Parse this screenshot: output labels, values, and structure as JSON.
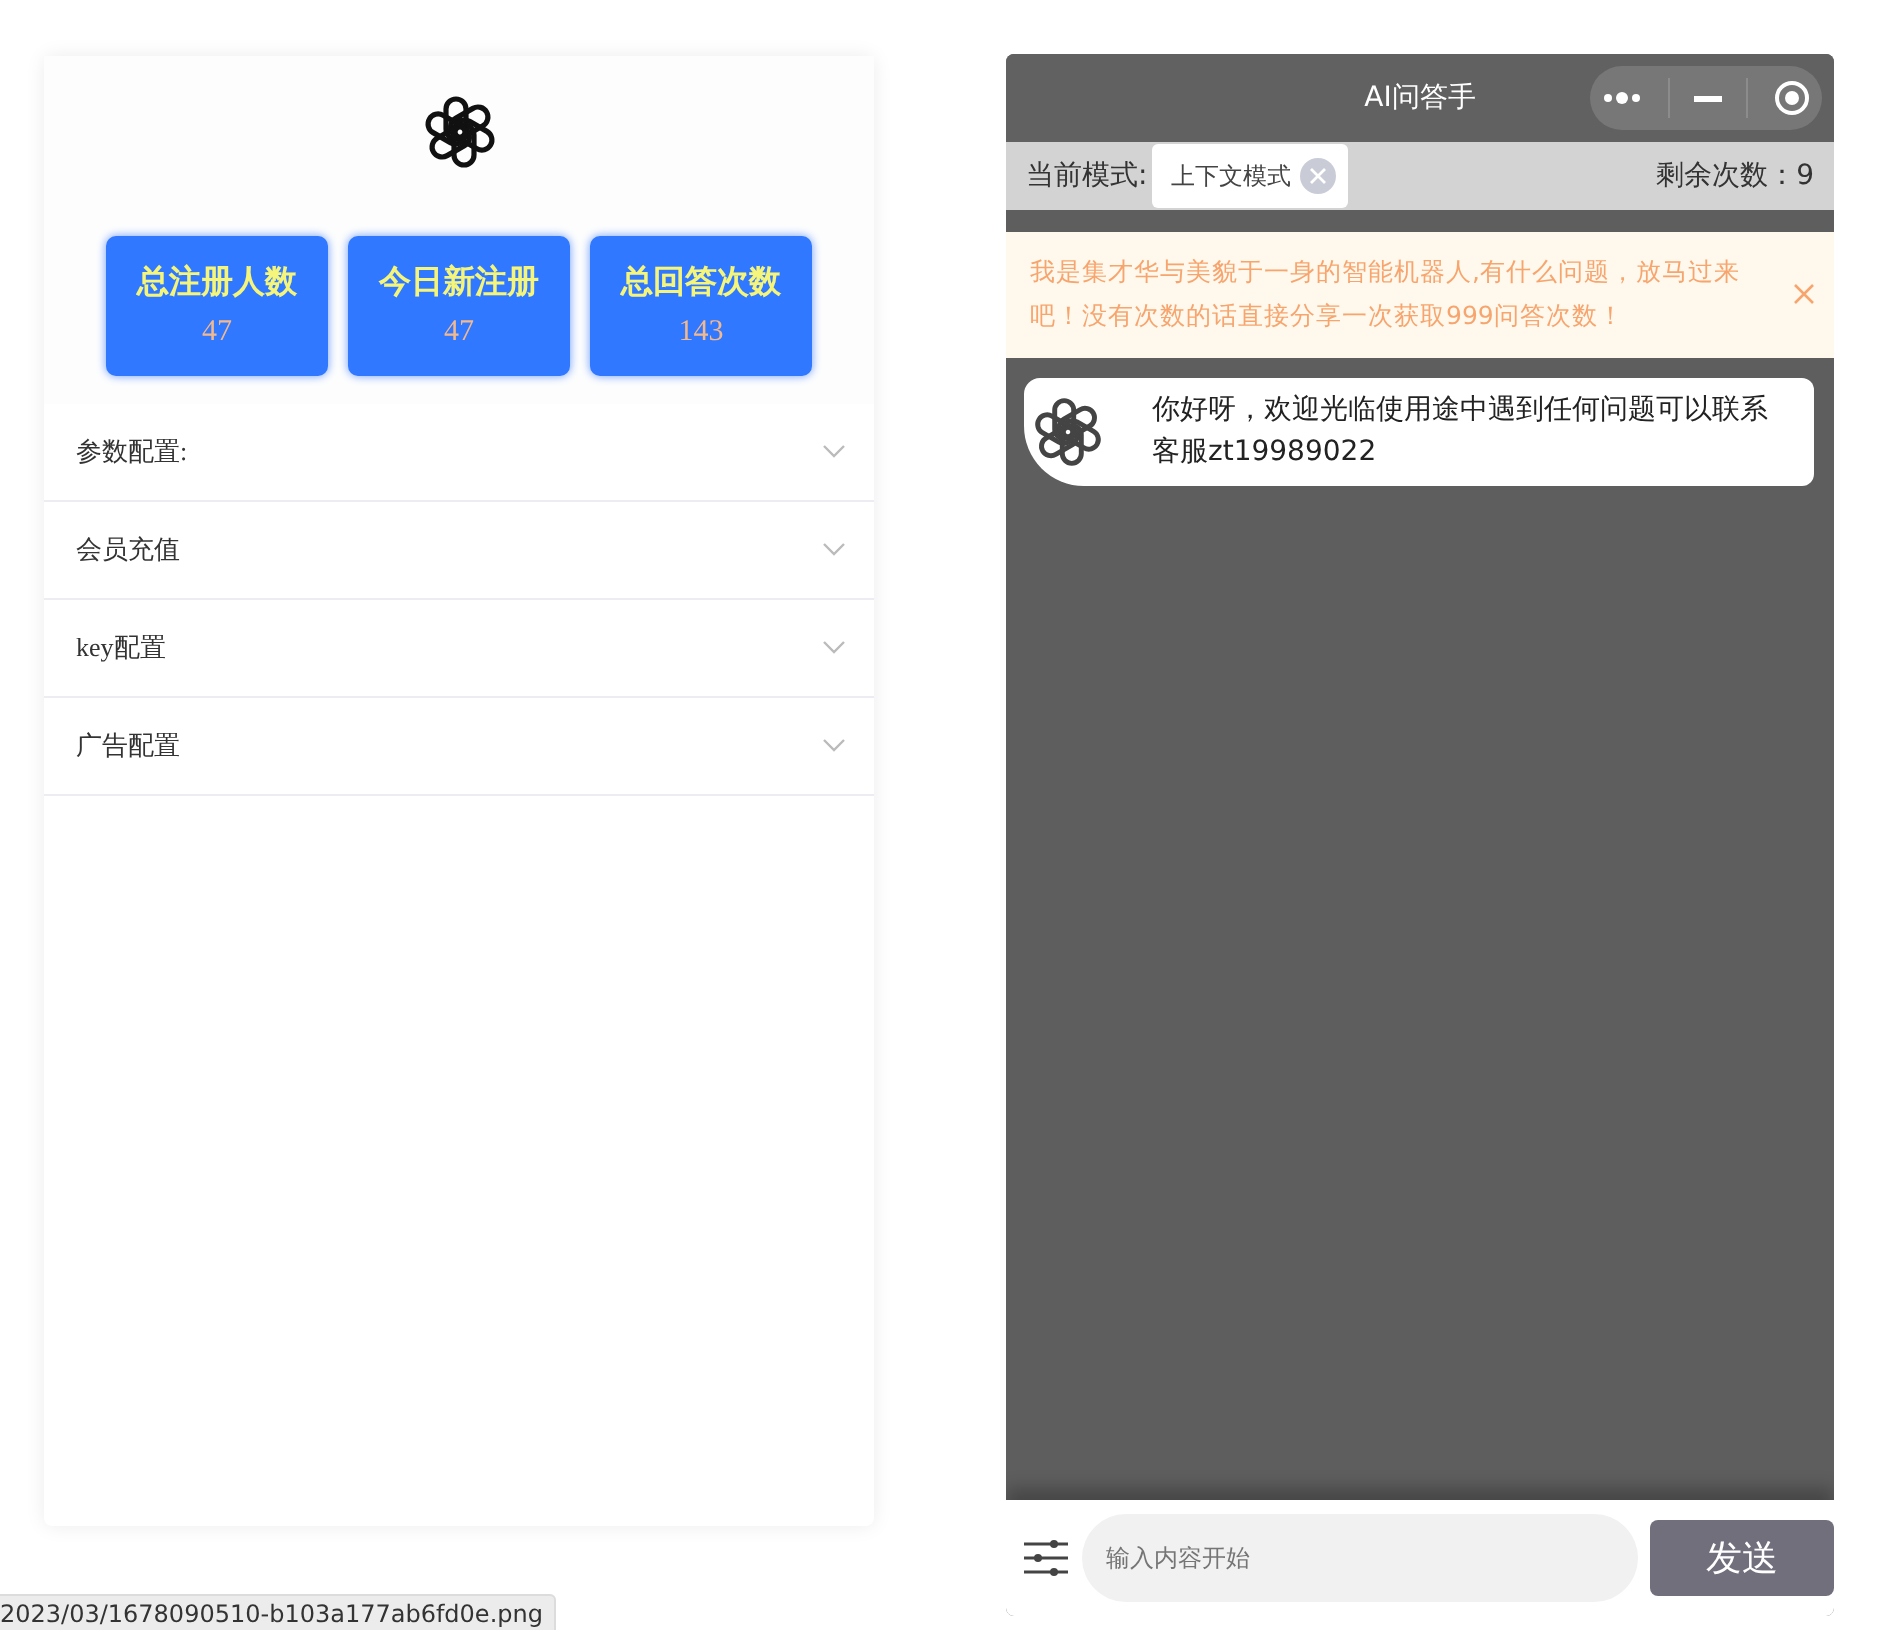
{
  "admin": {
    "stats": [
      {
        "label": "总注册人数",
        "value": "47"
      },
      {
        "label": "今日新注册",
        "value": "47"
      },
      {
        "label": "总回答次数",
        "value": "143"
      }
    ],
    "sections": [
      {
        "label": "参数配置:",
        "expanded": false
      },
      {
        "label": "会员充值",
        "expanded": false
      },
      {
        "label": "key配置",
        "expanded": false
      },
      {
        "label": "广告配置",
        "expanded": false
      }
    ]
  },
  "chat": {
    "title": "AI问答手",
    "mode_label": "当前模式:",
    "mode": "上下文模式",
    "remaining": "剩余次数：9",
    "notice": "我是集才华与美貌于一身的智能机器人,有什么问题，放马过来吧！没有次数的话直接分享一次获取999问答次数！",
    "messages": [
      {
        "text": "你好呀，欢迎光临使用途中遇到任何问题可以联系客服zt19989022"
      }
    ],
    "input": {
      "placeholder": "输入内容开始"
    },
    "send": "发送"
  },
  "status_tooltip": "2023/03/1678090510-b103a177ab6fd0e.png"
}
